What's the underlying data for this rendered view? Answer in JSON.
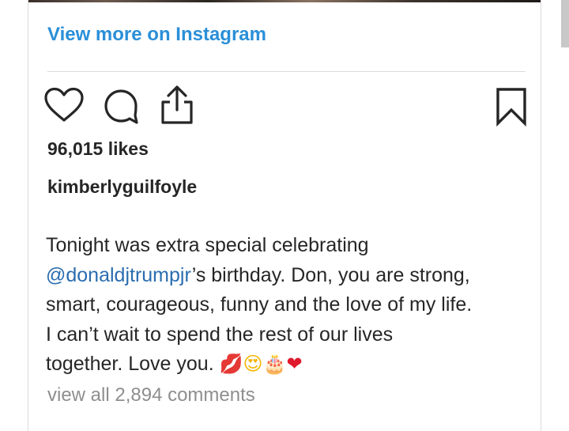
{
  "embed": {
    "view_more_link": "View more on Instagram",
    "likes": "96,015 likes",
    "username": "kimberlyguilfoyle",
    "caption": {
      "line1": "Tonight was extra special celebrating",
      "mention": "@donaldjtrumpjr",
      "line2_rest": "’s birthday. Don, you are strong,",
      "line3": "smart, courageous, funny and the love of my life.",
      "line4": "I can’t wait to spend the rest of our lives",
      "line5": "together. Love you.",
      "emojis": [
        "💋",
        "😍",
        "🎂",
        "❤"
      ]
    },
    "view_comments": "view all 2,894 comments"
  },
  "icons": [
    "heart-icon",
    "comment-icon",
    "share-icon",
    "bookmark-icon"
  ],
  "colors": {
    "link_blue": "#2a8fd8",
    "mention_blue": "#2a6db0",
    "text": "#262626",
    "muted": "#8e8e8e",
    "divider": "#dbdbdb"
  }
}
